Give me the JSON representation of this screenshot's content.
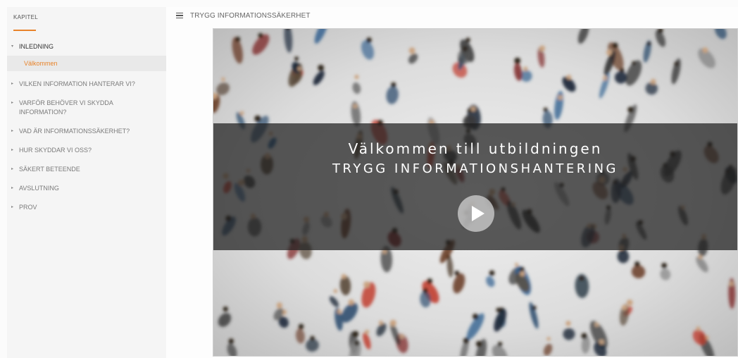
{
  "sidebar": {
    "header": "KAPITEL",
    "chapters": [
      {
        "label": "INLEDNING",
        "active": true,
        "sub": "Välkommen"
      },
      {
        "label": "VILKEN INFORMATION HANTERAR VI?"
      },
      {
        "label": "VARFÖR BEHÖVER VI SKYDDA INFORMATION?"
      },
      {
        "label": "VAD ÄR INFORMATIONSSÄKERHET?"
      },
      {
        "label": "HUR SKYDDAR VI OSS?"
      },
      {
        "label": "SÄKERT BETEENDE"
      },
      {
        "label": "AVSLUTNING"
      },
      {
        "label": "PROV"
      }
    ]
  },
  "header": {
    "title": "TRYGG INFORMATIONSSÄKERHET",
    "menu_icon": "hamburger-menu-icon"
  },
  "video": {
    "line1": "Välkommen till utbildningen",
    "line2": "TRYGG INFORMATIONSHANTERING",
    "play_icon": "play-icon"
  },
  "colors": {
    "accent": "#e8832a",
    "banner": "#1e1e1e",
    "sidebar_bg": "#f5f5f5"
  }
}
